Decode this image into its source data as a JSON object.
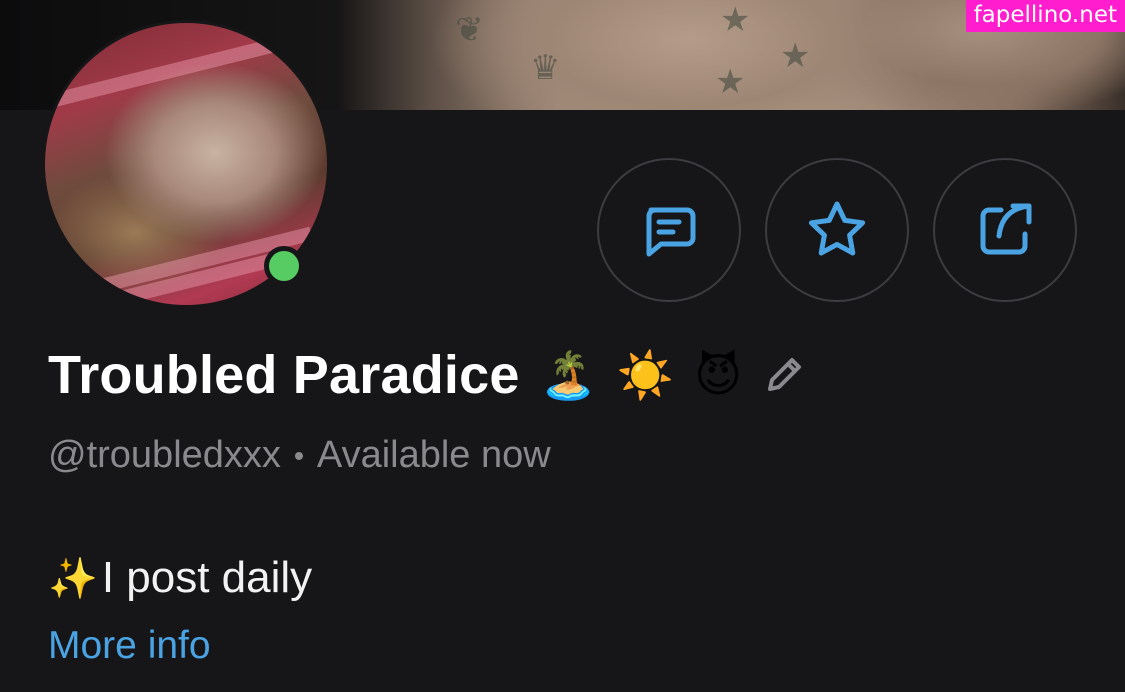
{
  "watermark": "fapellino.net",
  "profile": {
    "display_name": "Troubled Paradice",
    "name_emojis": [
      "🏝️",
      "☀️",
      "😈"
    ],
    "username": "@troubledxxx",
    "status": "Available now",
    "online": true,
    "bio": "I post daily",
    "bio_prefix_icon": "sparkles-icon",
    "more_info_label": "More info"
  },
  "actions": [
    {
      "name": "message-button",
      "icon": "message-icon"
    },
    {
      "name": "favorite-button",
      "icon": "star-icon"
    },
    {
      "name": "share-button",
      "icon": "share-icon"
    }
  ],
  "colors": {
    "background": "#161618",
    "accent": "#4aa3e2",
    "online": "#56cc63",
    "muted_text": "#8a8a8e",
    "watermark_bg": "#ff1dce"
  }
}
